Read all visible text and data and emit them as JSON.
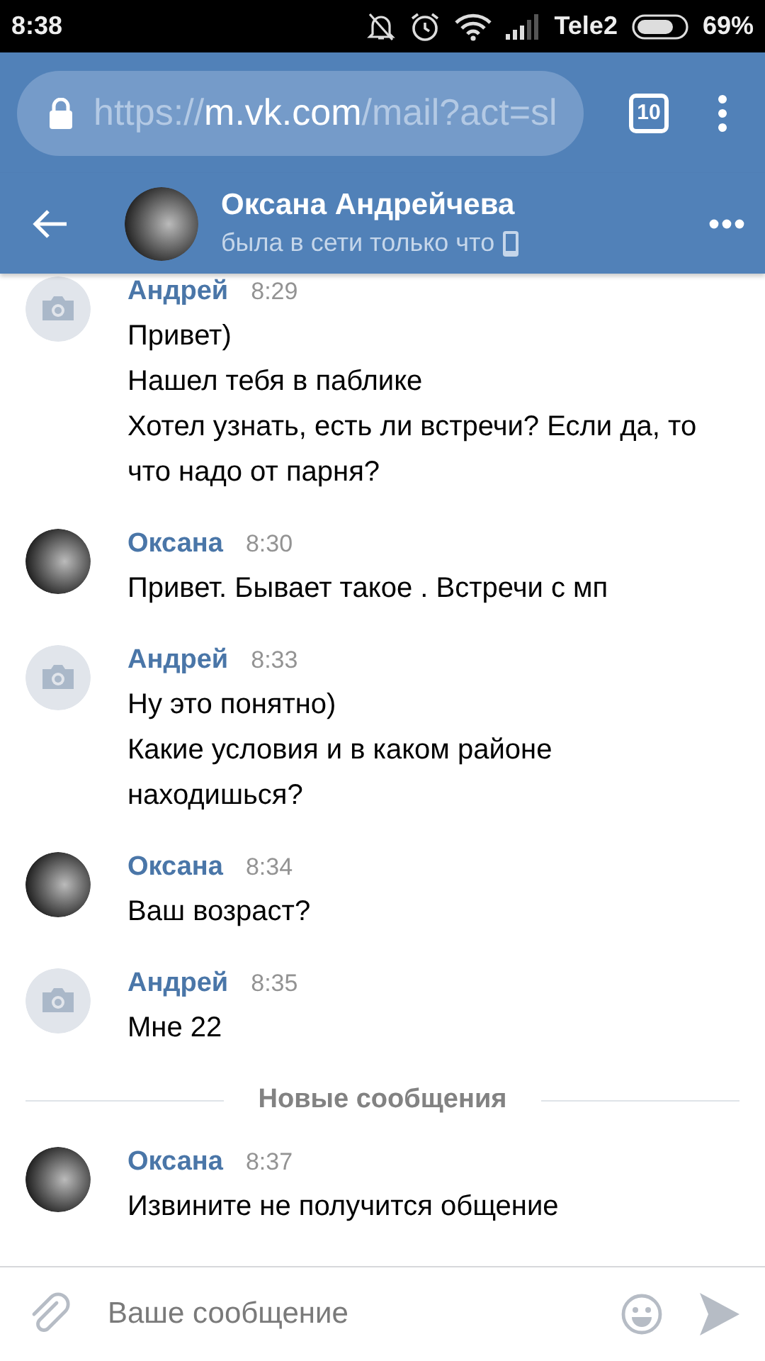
{
  "status_bar": {
    "time": "8:38",
    "carrier": "Tele2",
    "battery": "69%"
  },
  "browser": {
    "url": {
      "scheme": "https://",
      "host": "m.vk.com",
      "path": "/mail?act=sl"
    },
    "tabs_count": "10"
  },
  "chat_header": {
    "name": "Оксана Андрейчева",
    "status": "была в сети только что"
  },
  "messages": [
    {
      "kind": "message",
      "avatar": {
        "kind": "camera"
      },
      "author": "Андрей",
      "time": "8:29",
      "lines": [
        "Привет)",
        "Нашел тебя в паблике",
        "Хотел узнать, есть ли встречи? Если да, то что надо от парня?"
      ]
    },
    {
      "kind": "message",
      "avatar": {
        "kind": "photo"
      },
      "author": "Оксана",
      "time": "8:30",
      "lines": [
        "Привет. Бывает такое . Встречи с мп"
      ]
    },
    {
      "kind": "message",
      "avatar": {
        "kind": "camera"
      },
      "author": "Андрей",
      "time": "8:33",
      "lines": [
        "Ну это понятно)",
        "Какие условия и в каком районе находишься?"
      ]
    },
    {
      "kind": "message",
      "avatar": {
        "kind": "photo"
      },
      "author": "Оксана",
      "time": "8:34",
      "lines": [
        "Ваш возраст?"
      ]
    },
    {
      "kind": "message",
      "avatar": {
        "kind": "camera"
      },
      "author": "Андрей",
      "time": "8:35",
      "lines": [
        "Мне 22"
      ]
    },
    {
      "kind": "divider",
      "label": "Новые сообщения"
    },
    {
      "kind": "message",
      "avatar": {
        "kind": "photo"
      },
      "author": "Оксана",
      "time": "8:37",
      "lines": [
        "Извините не получится общение"
      ]
    }
  ],
  "composer": {
    "placeholder": "Ваше сообщение"
  }
}
